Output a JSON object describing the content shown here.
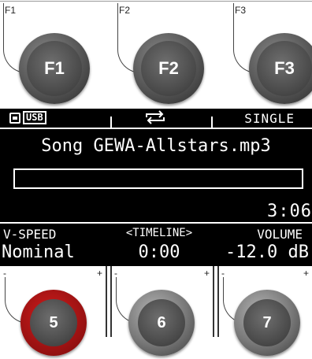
{
  "fkeys": [
    {
      "corner_label": "F1",
      "knob_label": "F1"
    },
    {
      "corner_label": "F2",
      "knob_label": "F2"
    },
    {
      "corner_label": "F3",
      "knob_label": "F3"
    }
  ],
  "screen": {
    "top": {
      "usb_label": "USB",
      "repeat_icon": "repeat-icon",
      "mode_label": "SINGLE"
    },
    "song_title": "Song GEWA-Allstars.mp3",
    "progress": 0,
    "time": "3:06",
    "params": [
      {
        "label": "V-SPEED",
        "value": "Nominal"
      },
      {
        "label": "<TIMELINE>",
        "value": "0:00"
      },
      {
        "label": "VOLUME",
        "value": "-12.0 dB"
      }
    ]
  },
  "encoders": [
    {
      "minus": "-",
      "plus": "+",
      "label": "5",
      "ring_color": "#d41c1c",
      "active": true
    },
    {
      "minus": "-",
      "plus": "+",
      "label": "6",
      "ring_color": "#777777",
      "active": false
    },
    {
      "minus": "-",
      "plus": "+",
      "label": "7",
      "ring_color": "#777777",
      "active": false
    }
  ]
}
